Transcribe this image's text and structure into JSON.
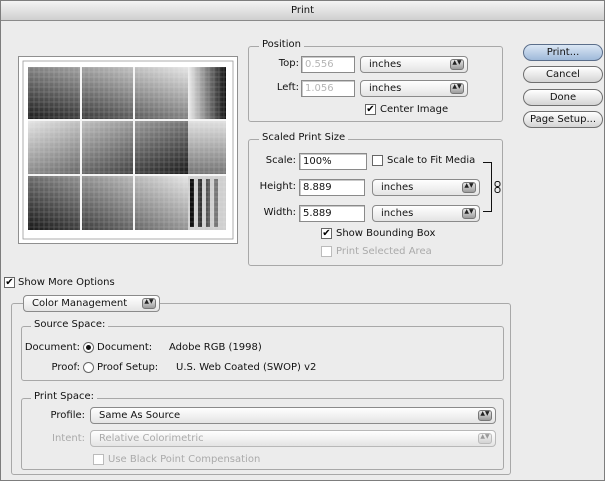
{
  "window": {
    "title": "Print"
  },
  "buttons": {
    "print": "Print...",
    "cancel": "Cancel",
    "done": "Done",
    "page_setup": "Page Setup..."
  },
  "position": {
    "group_label": "Position",
    "top_label": "Top:",
    "top_value": "0.556",
    "top_unit": "inches",
    "left_label": "Left:",
    "left_value": "1.056",
    "left_unit": "inches",
    "center_image_label": "Center Image",
    "center_image_checked": true
  },
  "scaled": {
    "group_label": "Scaled Print Size",
    "scale_label": "Scale:",
    "scale_value": "100%",
    "scale_to_fit_label": "Scale to Fit Media",
    "height_label": "Height:",
    "height_value": "8.889",
    "height_unit": "inches",
    "width_label": "Width:",
    "width_value": "5.889",
    "width_unit": "inches",
    "show_bounding_box_label": "Show Bounding Box",
    "print_selected_area_label": "Print Selected Area"
  },
  "more_options": {
    "label": "Show More Options"
  },
  "color": {
    "section_popup": "Color Management",
    "source_space_label": "Source Space:",
    "document_row_label": "Document:",
    "document_option": "Document:",
    "document_profile": "Adobe RGB (1998)",
    "proof_row_label": "Proof:",
    "proof_option": "Proof Setup:",
    "proof_profile": "U.S. Web Coated (SWOP) v2",
    "print_space_label": "Print Space:",
    "profile_label": "Profile:",
    "profile_value": "Same As Source",
    "intent_label": "Intent:",
    "intent_value": "Relative Colorimetric",
    "black_point_label": "Use Black Point Compensation"
  },
  "icons": {
    "check": "✔",
    "popup_arrows": "▲▼",
    "chain": "chain-link-icon"
  }
}
